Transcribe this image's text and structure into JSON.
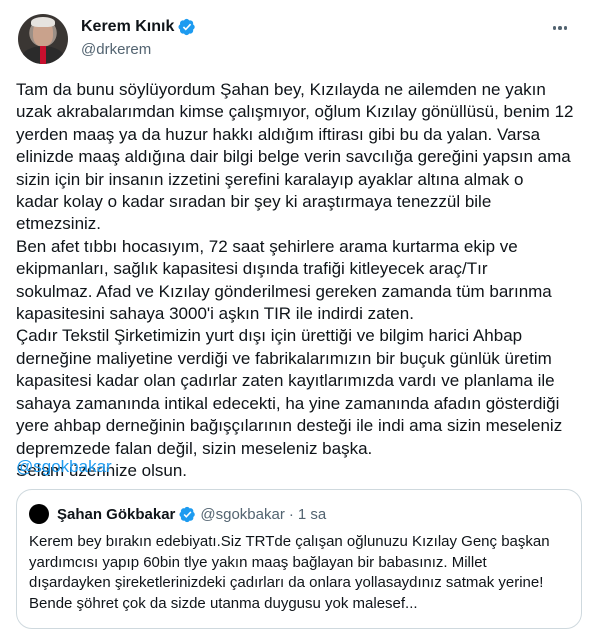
{
  "author": {
    "display_name": "Kerem Kınık",
    "handle": "@drkerem",
    "verified": true
  },
  "tweet": {
    "lines": [
      "Tam da bunu söylüyordum Şahan bey, Kızılayda ne ailemden ne yakın",
      "uzak akrabalarımdan kimse çalışmıyor, oğlum Kızılay gönüllüsü, benim 12",
      "yerden maaş ya da huzur hakkı aldığım iftirası gibi bu da yalan. Varsa",
      "elinizde maaş aldığına dair bilgi belge verin savcılığa gereğini yapsın ama",
      "sizin için bir insanın izzetini şerefini karalayıp ayaklar altına almak o",
      "kadar kolay o kadar sıradan bir şey ki araştırmaya tenezzül bile",
      "etmezsiniz.",
      "Ben afet tıbbı hocasıyım, 72 saat şehirlere arama kurtarma ekip ve",
      "ekipmanları, sağlık kapasitesi dışında trafiği kitleyecek araç/Tır",
      "sokulmaz. Afad ve Kızılay gönderilmesi gereken zamanda tüm barınma",
      "kapasitesini sahaya 3000'i aşkın TIR ile indirdi zaten.",
      "Çadır Tekstil Şirketimizin yurt dışı için ürettiği ve bilgim harici Ahbap",
      "derneğine maliyetine verdiği ve fabrikalarımızın bir buçuk günlük üretim",
      "kapasitesi kadar olan çadırlar zaten kayıtlarımızda vardı ve planlama ile",
      "sahaya zamanında intikal edecekti, ha yine zamanında afadın gösterdiği",
      "yere ahbap derneğinin bağışçılarının desteği ile indi ama sizin meseleniz",
      "depremzede falan değil, sizin meseleniz başka.",
      "Selam üzerinize olsun."
    ],
    "mention": "@sgokbakar"
  },
  "quoted": {
    "display_name": "Şahan Gökbakar",
    "handle": "@sgokbakar",
    "separator": "·",
    "time": "1 sa",
    "verified": true,
    "lines": [
      "Kerem bey bırakın edebiyatı.Siz TRTde çalışan oğlunuzu Kızılay Genç başkan",
      "yardımcısı yapıp 60bin tlye yakın maaş bağlayan bir babasınız. Millet",
      "dışardayken şireketlerinizdeki çadırları da onlara yollasaydınız satmak yerine!",
      "Bende şöhret çok da sizde utanma duygusu yok malesef..."
    ]
  },
  "colors": {
    "verified_blue": "#1d9bf0",
    "link_blue": "#1d9bf0",
    "text": "#0f1419",
    "secondary_text": "#536471",
    "border": "#cfd9de"
  },
  "icons": {
    "verified": "verified-badge-icon",
    "more": "more-options-icon"
  }
}
